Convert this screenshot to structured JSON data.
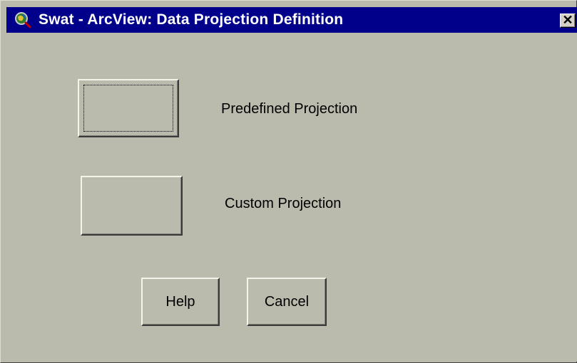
{
  "window": {
    "title": "Swat - ArcView: Data Projection Definition",
    "icon": "arcview-globe-icon",
    "close_glyph": "✕"
  },
  "options": {
    "predefined_label": "Predefined Projection",
    "custom_label": "Custom Projection"
  },
  "buttons": {
    "help_label": "Help",
    "cancel_label": "Cancel"
  },
  "colors": {
    "titlebar": "#00008b",
    "dialog_background": "#bbbbad"
  }
}
